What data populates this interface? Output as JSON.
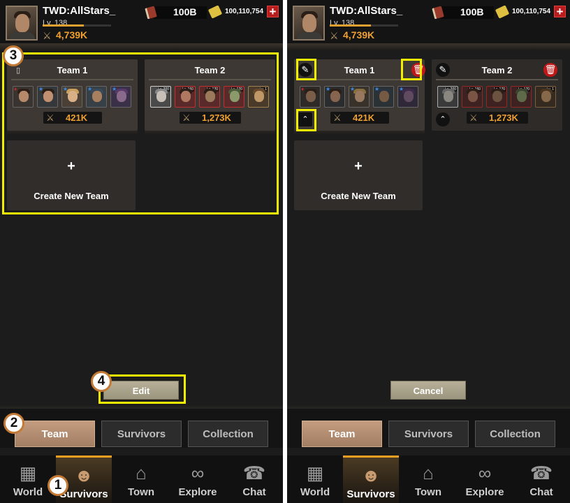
{
  "player": {
    "name": "TWD:AllStars_",
    "level": "Lv. 138",
    "level_progress": 0.6,
    "power": "4,739K"
  },
  "currency": {
    "books": "100B",
    "tickets": "100,110,754",
    "add_symbol": "+"
  },
  "teams": [
    {
      "name": "Team 1",
      "power": "421K",
      "heroes": [
        {
          "skin": "#b48a6a"
        },
        {
          "skin": "#c09070"
        },
        {
          "skin": "#d8b088"
        },
        {
          "skin": "#a88060"
        },
        {
          "skin": "#8a6a8a"
        }
      ]
    },
    {
      "name": "Team 2",
      "power": "1,273K",
      "heroes": [
        {
          "skin": "#c8c0b8",
          "lv": "Lv. 200"
        },
        {
          "skin": "#b07860",
          "lv": "Lv. 160"
        },
        {
          "skin": "#9a7a5a",
          "lv": "Lv. 120"
        },
        {
          "skin": "#8a9a6a",
          "lv": "Lv. 120"
        },
        {
          "skin": "#c09868",
          "lv": "Lv. 1"
        }
      ]
    }
  ],
  "right_team2_levels": [
    "Lv. 200",
    "Lv. 160",
    "Lv. 170",
    "Lv. 170",
    "Lv. 1"
  ],
  "create_team": {
    "plus": "+",
    "label": "Create New Team"
  },
  "buttons": {
    "edit": "Edit",
    "cancel": "Cancel"
  },
  "subtabs": [
    "Team",
    "Survivors",
    "Collection"
  ],
  "nav": [
    "World",
    "Survivors",
    "Town",
    "Explore",
    "Chat"
  ],
  "steps": [
    "1",
    "2",
    "3",
    "4"
  ],
  "colors": {
    "highlight": "#f2f000",
    "accent": "#f0a030",
    "delete": "#c01818"
  }
}
